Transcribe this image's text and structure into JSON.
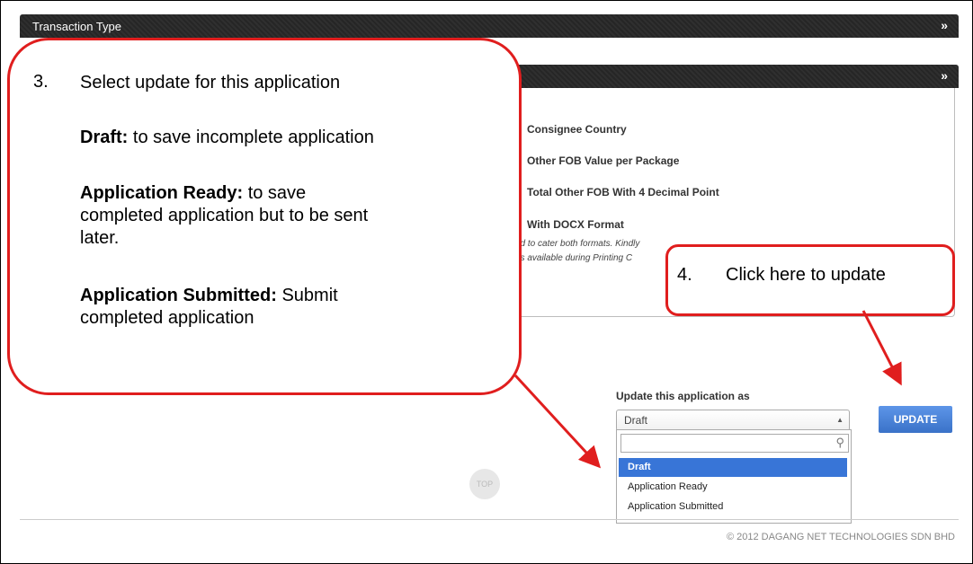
{
  "sections": {
    "transaction_type": "Transaction Type",
    "collapse_glyph": "»"
  },
  "options": [
    "Consignee Country",
    "Other FOB Value per Package",
    "Total Other FOB With 4 Decimal Point",
    "With DOCX Format"
  ],
  "notes": [
    "ced to cater both formats. Kindly",
    "n is available during Printing C"
  ],
  "callout3": {
    "number": "3.",
    "heading": "Select update for this application",
    "draft_bold": "Draft:",
    "draft_text": " to save incomplete application",
    "ready_bold": "Application Ready:",
    "ready_text": " to save",
    "ready_line2": "completed application but to be sent",
    "ready_line3": "later.",
    "submitted_bold": "Application Submitted:",
    "submitted_text": " Submit",
    "submitted_line2": "completed application"
  },
  "callout4": {
    "number": "4.",
    "text": "Click here to update"
  },
  "update": {
    "label": "Update this application as",
    "selected": "Draft",
    "options": [
      "Draft",
      "Application Ready",
      "Application Submitted"
    ],
    "button": "UPDATE"
  },
  "top_label": "TOP",
  "footer": "© 2012 DAGANG NET TECHNOLOGIES SDN BHD",
  "colors": {
    "callout_border": "#e01e1e",
    "accent_blue": "#3875d7"
  }
}
